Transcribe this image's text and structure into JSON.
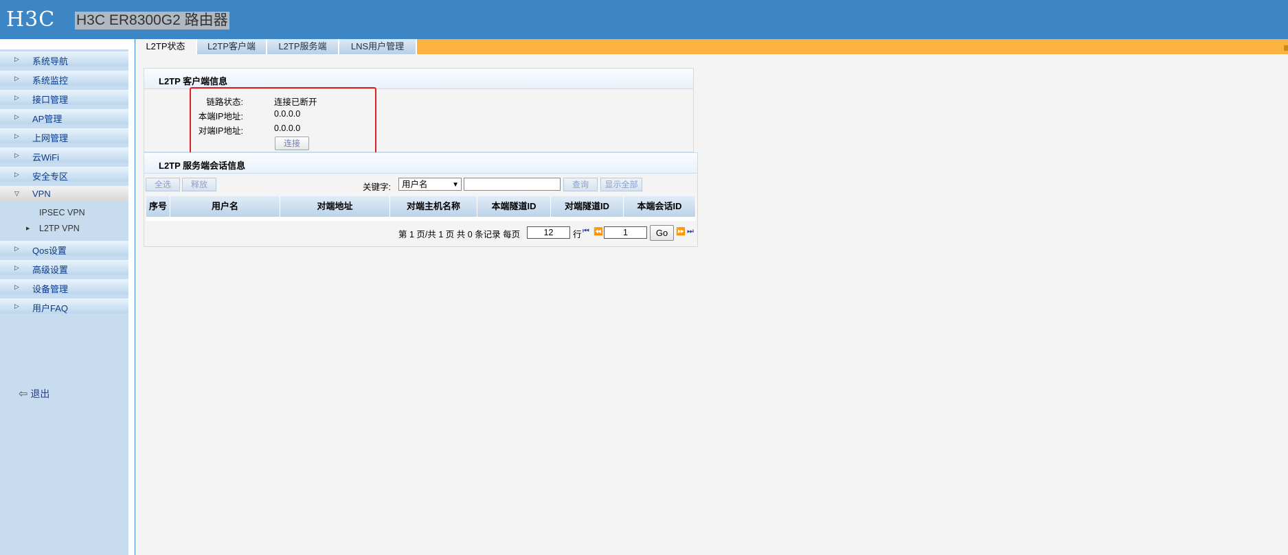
{
  "header": {
    "logo": "H3C",
    "model": "H3C ER8300G2 路由器"
  },
  "nav": {
    "items": [
      {
        "label": "系统导航"
      },
      {
        "label": "系统监控"
      },
      {
        "label": "接口管理"
      },
      {
        "label": "AP管理"
      },
      {
        "label": "上网管理"
      },
      {
        "label": "云WiFi"
      },
      {
        "label": "安全专区"
      },
      {
        "label": "VPN"
      }
    ],
    "vpn_sub": [
      {
        "label": "IPSEC VPN"
      },
      {
        "label": "L2TP VPN"
      }
    ],
    "items_after": [
      {
        "label": "Qos设置"
      },
      {
        "label": "高级设置"
      },
      {
        "label": "设备管理"
      },
      {
        "label": "用户FAQ"
      }
    ],
    "logout": "退出"
  },
  "tabs": [
    {
      "label": "L2TP状态",
      "active": true
    },
    {
      "label": "L2TP客户端"
    },
    {
      "label": "L2TP服务端"
    },
    {
      "label": "LNS用户管理"
    }
  ],
  "client_info": {
    "title": "L2TP 客户端信息",
    "rows": [
      {
        "label": "链路状态:",
        "value": "连接已断开"
      },
      {
        "label": "本端IP地址:",
        "value": "0.0.0.0"
      },
      {
        "label": "对端IP地址:",
        "value": "0.0.0.0"
      }
    ],
    "connect_label": "连接"
  },
  "server_sessions": {
    "title": "L2TP 服务端会话信息",
    "select_all_label": "全选",
    "release_label": "释放",
    "keyword_label": "关键字:",
    "keyword_selected": "用户名",
    "query_label": "查询",
    "show_all_label": "显示全部",
    "columns": [
      "序号",
      "用户名",
      "对端地址",
      "对端主机名称",
      "本端隧道ID",
      "对端隧道ID",
      "本端会话ID"
    ],
    "pager": {
      "text_before": "第 1 页/共 1 页 共 0 条记录 每页",
      "per_page": "12",
      "text_rows": "行",
      "page": "1",
      "go_label": "Go"
    }
  },
  "colors": {
    "header_blue": "#3d86c6",
    "tab_orange": "#fbb23f",
    "highlight_red": "#e02020"
  }
}
